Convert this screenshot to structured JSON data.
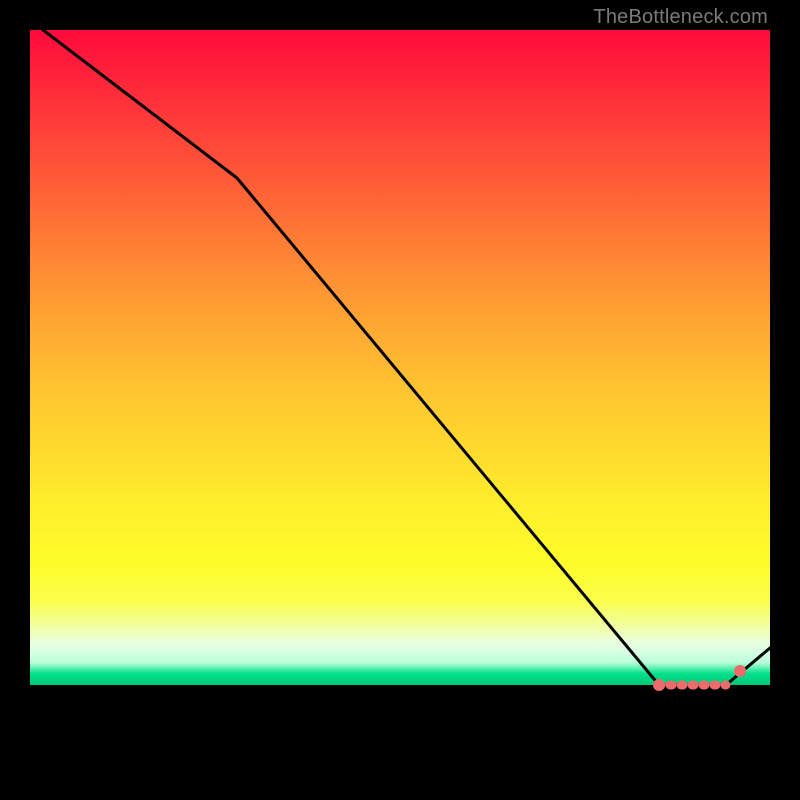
{
  "watermark": "TheBottleneck.com",
  "chart_data": {
    "type": "line",
    "series": [
      {
        "name": "bottleneck-curve",
        "x": [
          0.0,
          0.28,
          0.85,
          0.94,
          1.0
        ],
        "values": [
          1.0,
          0.8,
          0.0,
          0.0,
          0.05
        ]
      }
    ],
    "xlim": [
      0,
      1
    ],
    "ylim": [
      0,
      1
    ],
    "xlabel": "",
    "ylabel": "",
    "title": "",
    "marker_range_x": [
      0.85,
      0.94
    ],
    "marker_y": 0.0,
    "end_marker": {
      "x": 0.94,
      "y": 0.0
    },
    "background_gradient": {
      "top": "#ff0a3c",
      "mid": "#fff02a",
      "bottom": "#00e08a"
    },
    "colors": {
      "curve": "#000000",
      "marker": "#ee6b6b",
      "frame": "#000000"
    }
  }
}
